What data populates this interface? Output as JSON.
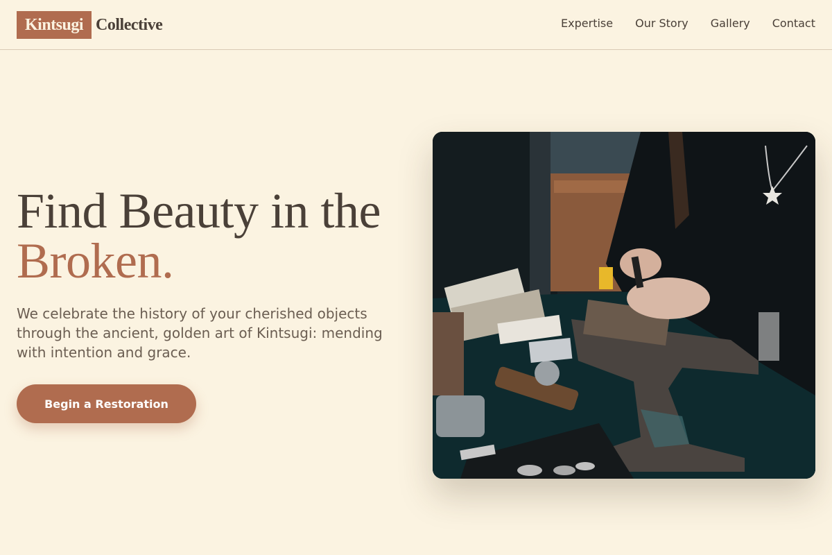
{
  "brand": {
    "mark": "Kintsugi",
    "name": "Collective",
    "accent_color": "#b06c4f",
    "background_color": "#fbf3e1"
  },
  "nav": {
    "items": [
      {
        "label": "Expertise"
      },
      {
        "label": "Our Story"
      },
      {
        "label": "Gallery"
      },
      {
        "label": "Contact"
      }
    ]
  },
  "hero": {
    "title_line1": "Find Beauty in the",
    "title_line2": "Broken.",
    "description": "We celebrate the history of your cherished objects through the ancient, golden art of Kintsugi: mending with intention and grace.",
    "cta_label": "Begin a Restoration",
    "image_alt": "Artisan working with tools at a jeweler's anvil"
  }
}
